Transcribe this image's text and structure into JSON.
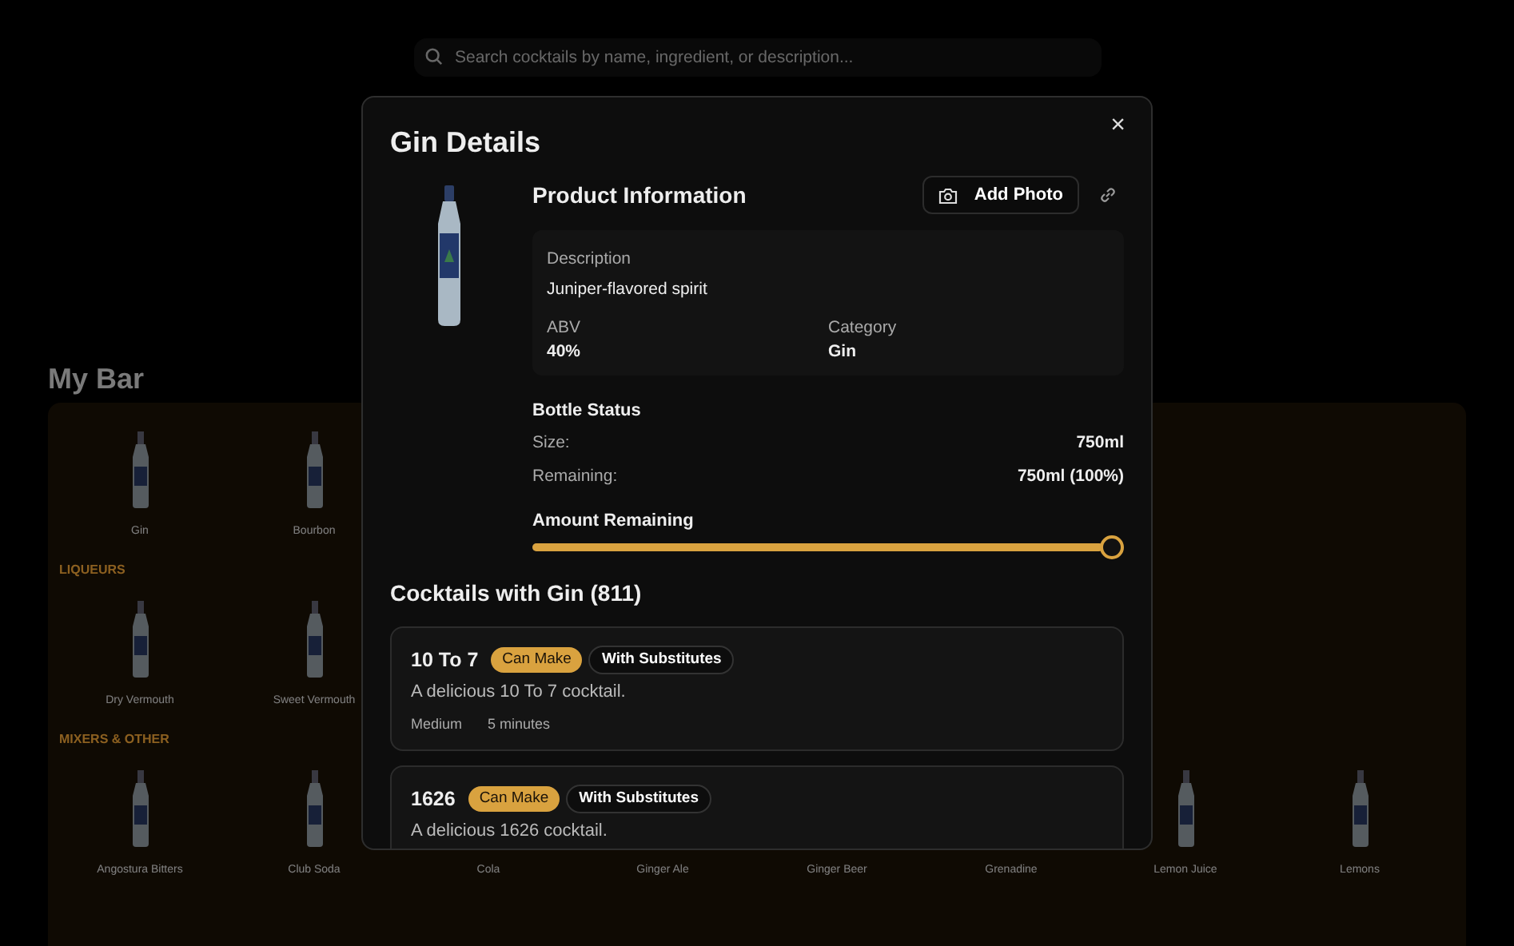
{
  "background": {
    "search": {
      "placeholder": "Search cocktails by name, ingredient, or description..."
    },
    "title": "My Bar",
    "sections": [
      {
        "items": [
          "Gin",
          "Bourbon"
        ]
      },
      {
        "heading": "LIQUEURS",
        "items": [
          "Dry Vermouth",
          "Sweet Vermouth"
        ]
      },
      {
        "heading": "MIXERS & OTHER",
        "items": [
          "Angostura Bitters",
          "Club Soda",
          "Cola",
          "Ginger Ale",
          "Ginger Beer",
          "Grenadine",
          "Lemon Juice",
          "Lemons"
        ]
      }
    ]
  },
  "modal": {
    "title": "Gin Details",
    "close": "×",
    "product": {
      "heading": "Product Information",
      "add_photo": "Add Photo",
      "description_label": "Description",
      "description": "Juniper-flavored spirit",
      "fields": [
        {
          "label": "ABV",
          "value": "40%"
        },
        {
          "label": "Category",
          "value": "Gin"
        }
      ]
    },
    "bottle_status": {
      "heading": "Bottle Status",
      "rows": [
        {
          "label": "Size:",
          "value": "750ml"
        },
        {
          "label": "Remaining:",
          "value": "750ml (100%)"
        }
      ]
    },
    "amount": {
      "label": "Amount Remaining",
      "level": 1
    },
    "cocktails": {
      "heading": "Cocktails with Gin (811)",
      "items": [
        {
          "name": "10 To 7",
          "badges": [
            {
              "kind": "can",
              "text": "Can Make"
            },
            {
              "kind": "subs",
              "text": "With Substitutes"
            }
          ],
          "description": "A delicious 10 To 7 cocktail.",
          "meta": [
            "Medium",
            "5 minutes"
          ]
        },
        {
          "name": "1626",
          "badges": [
            {
              "kind": "can",
              "text": "Can Make"
            },
            {
              "kind": "subs",
              "text": "With Substitutes"
            }
          ],
          "description": "A delicious 1626 cocktail."
        }
      ]
    }
  }
}
